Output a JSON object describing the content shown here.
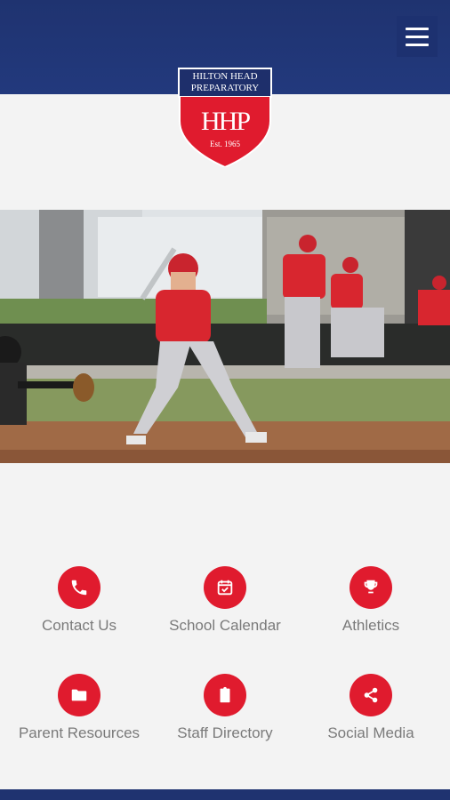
{
  "header": {
    "menu_icon": "hamburger-menu-icon",
    "logo": {
      "line1": "HILTON HEAD",
      "line2": "PREPARATORY",
      "monogram": "HHP",
      "est": "Est. 1965"
    }
  },
  "hero": {
    "description": "baseball-batter-photo"
  },
  "tiles": [
    {
      "label": "Contact Us",
      "icon": "phone-icon"
    },
    {
      "label": "School Calendar",
      "icon": "calendar-icon"
    },
    {
      "label": "Athletics",
      "icon": "trophy-icon"
    },
    {
      "label": "Parent Resources",
      "icon": "folder-icon"
    },
    {
      "label": "Staff Directory",
      "icon": "clipboard-icon"
    },
    {
      "label": "Social Media",
      "icon": "share-icon"
    }
  ],
  "colors": {
    "navy": "#1f3370",
    "accent_red": "#e01b2e",
    "label_gray": "#7a7a7a"
  }
}
